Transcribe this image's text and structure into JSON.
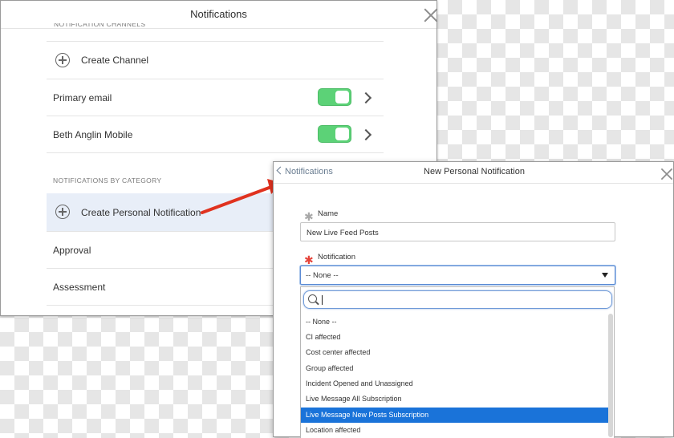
{
  "back_panel": {
    "title": "Notifications",
    "channels_header": "NOTIFICATION CHANNELS",
    "create_channel": "Create Channel",
    "channels": [
      {
        "label": "Primary email",
        "enabled": true
      },
      {
        "label": "Beth Anglin Mobile",
        "enabled": true
      }
    ],
    "category_header": "NOTIFICATIONS BY CATEGORY",
    "create_personal": "Create Personal Notification",
    "categories": [
      "Approval",
      "Assessment"
    ]
  },
  "dialog": {
    "back_label": "Notifications",
    "title": "New Personal Notification",
    "name_label": "Name",
    "name_value": "New Live Feed Posts",
    "notification_label": "Notification",
    "notification_value": "-- None --",
    "search_value": "",
    "options": [
      "-- None --",
      "CI affected",
      "Cost center affected",
      "Group affected",
      "Incident Opened and Unassigned",
      "Live Message All Subscription",
      "Live Message New Posts Subscription",
      "Location affected"
    ],
    "selected_option": "Live Message New Posts Subscription"
  },
  "colors": {
    "toggle_on": "#5cd277",
    "selection_blue": "#1a73d9",
    "arrow_red": "#e0321f",
    "required_red": "#e5433a"
  },
  "icons": [
    "close-icon",
    "plus-circle-icon",
    "chevron-right-icon",
    "chevron-left-icon",
    "search-icon",
    "caret-down-icon"
  ]
}
